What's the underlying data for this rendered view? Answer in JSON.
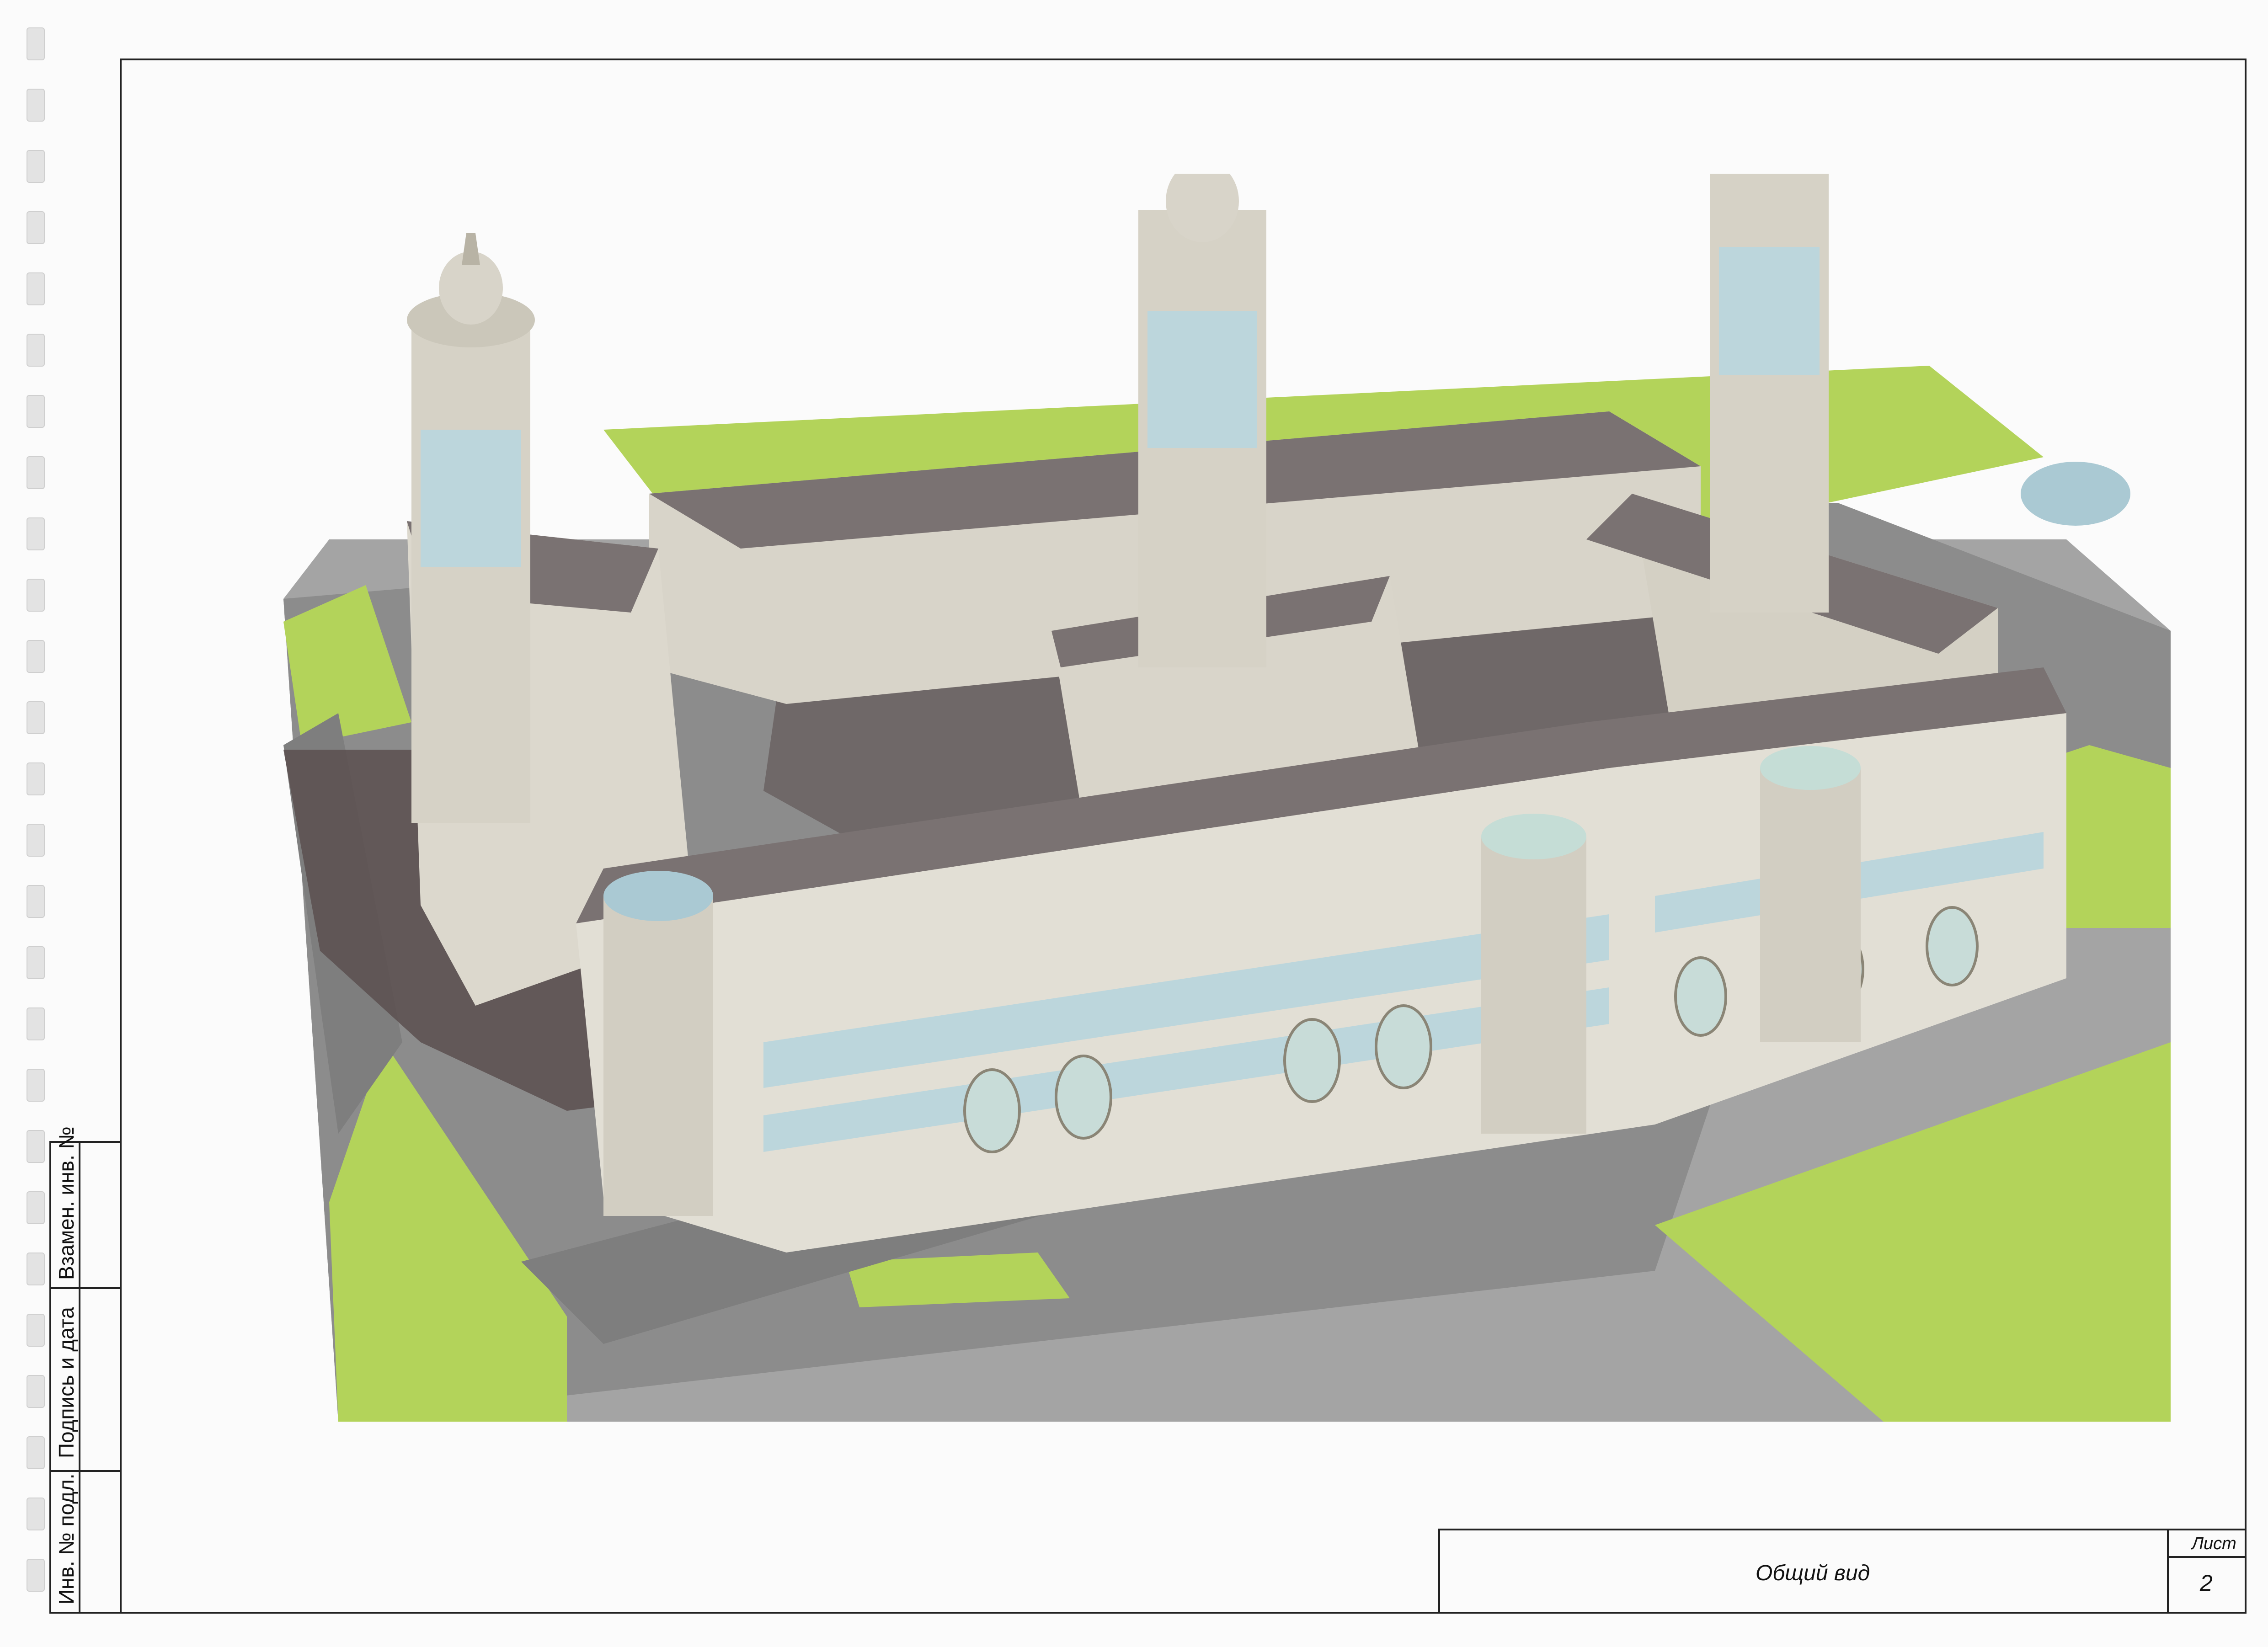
{
  "sheet": {
    "side_stamp": {
      "cells": [
        "Взамен. инв. №",
        "Подпись и дата",
        "Инв. № подл."
      ]
    },
    "title_block": {
      "title": "Общий вид",
      "sheet_label": "Лист",
      "sheet_number": "2"
    }
  },
  "render": {
    "description_icon": "architectural-render-image"
  },
  "colors": {
    "frame": "#222222",
    "lawn": "#b3d35a",
    "road": "#8a8a8a",
    "building": "#dedbd0",
    "roof": "#7a7272",
    "glass": "#bcd6dc"
  }
}
